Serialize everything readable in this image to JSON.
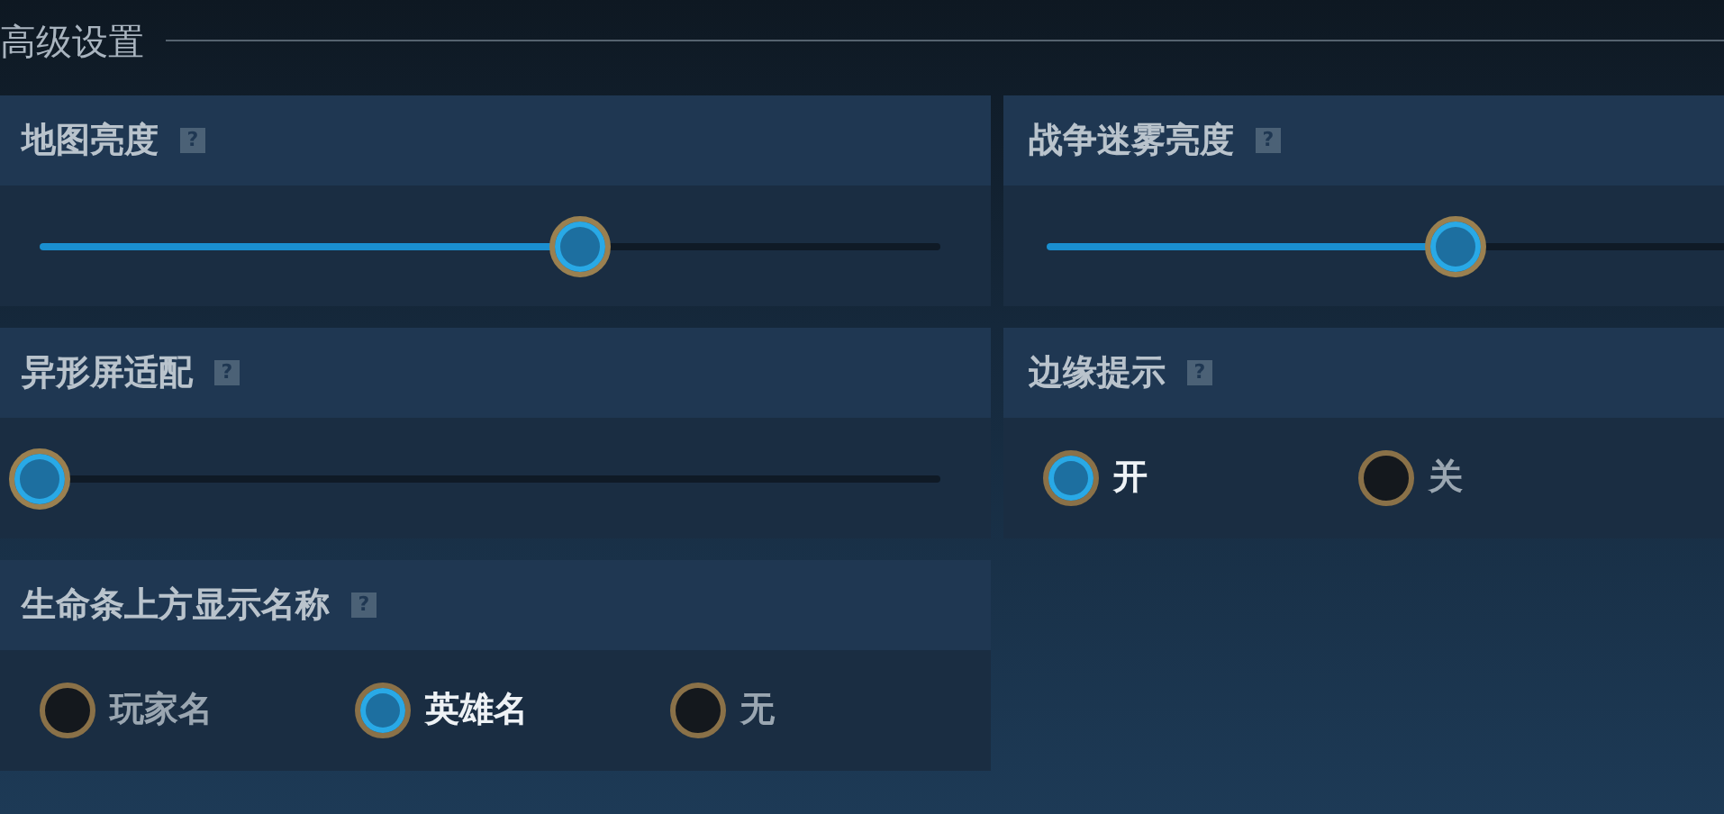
{
  "title": "高级设置",
  "cards": [
    {
      "kind": "slider",
      "label": "地图亮度",
      "help": "?",
      "level": 0.6
    },
    {
      "kind": "slider",
      "label": "战争迷雾亮度",
      "help": "?",
      "level": 0.6
    },
    {
      "kind": "slider",
      "label": "异形屏适配",
      "help": "?",
      "level": 0
    },
    {
      "kind": "radio",
      "label": "边缘提示",
      "help": "?",
      "options": [
        {
          "label": "开",
          "selected": true
        },
        {
          "label": "关",
          "selected": false
        }
      ]
    },
    {
      "kind": "radio",
      "label": "生命条上方显示名称",
      "help": "?",
      "options": [
        {
          "label": "玩家名",
          "selected": false
        },
        {
          "label": "英雄名",
          "selected": true
        },
        {
          "label": "无",
          "selected": false
        }
      ]
    }
  ]
}
